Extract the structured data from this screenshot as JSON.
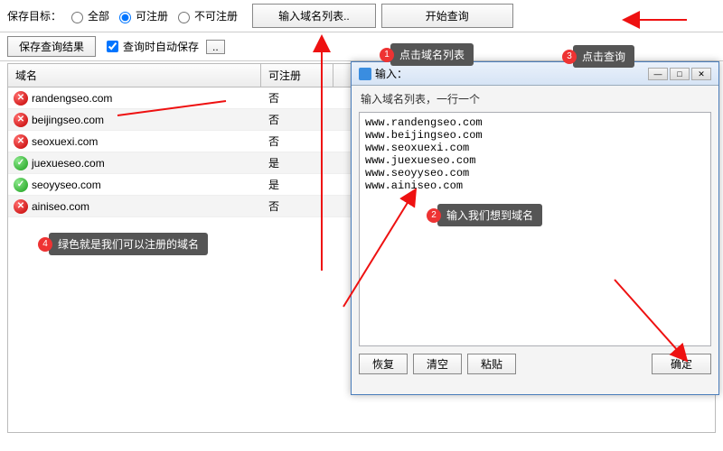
{
  "toolbar": {
    "save_target_label": "保存目标：",
    "radio_all": "全部",
    "radio_registerable": "可注册",
    "radio_not_registerable": "不可注册",
    "input_list_btn": "输入域名列表..",
    "start_query_btn": "开始查询"
  },
  "row2": {
    "save_result_btn": "保存查询结果",
    "autosave_label": "查询时自动保存",
    "dots_btn": ".."
  },
  "table": {
    "col_domain": "域名",
    "col_reg": "可注册",
    "rows": [
      {
        "domain": "randengseo.com",
        "reg": "否",
        "ok": false
      },
      {
        "domain": "beijingseo.com",
        "reg": "否",
        "ok": false
      },
      {
        "domain": "seoxuexi.com",
        "reg": "否",
        "ok": false
      },
      {
        "domain": "juexueseo.com",
        "reg": "是",
        "ok": true
      },
      {
        "domain": "seoyyseo.com",
        "reg": "是",
        "ok": true
      },
      {
        "domain": "ainiseo.com",
        "reg": "否",
        "ok": false
      }
    ]
  },
  "dialog": {
    "title": "输入：",
    "hint": "输入域名列表，一行一个",
    "lines": [
      "www.randengseo.com",
      "www.beijingseo.com",
      "www.seoxuexi.com",
      "www.juexueseo.com",
      "www.seoyyseo.com",
      "www.ainiseo.com"
    ],
    "btn_restore": "恢复",
    "btn_clear": "清空",
    "btn_paste": "粘贴",
    "btn_ok": "确定"
  },
  "callouts": {
    "c1": "点击域名列表",
    "c2": "输入我们想到域名",
    "c3": "点击查询",
    "c4": "绿色就是我们可以注册的域名"
  }
}
